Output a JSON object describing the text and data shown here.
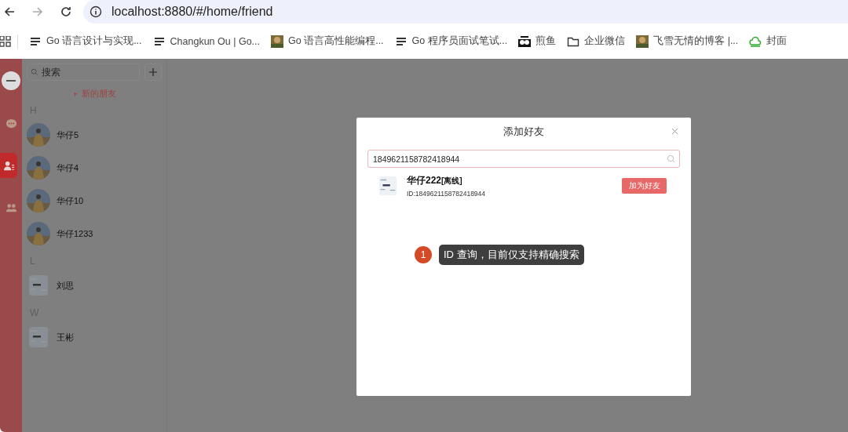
{
  "browser": {
    "url": "localhost:8880/#/home/friend",
    "bookmarks": [
      {
        "label": "Go 语言设计与实现...",
        "kind": "lines"
      },
      {
        "label": "Changkun Ou | Go...",
        "kind": "lines"
      },
      {
        "label": "Go 语言高性能编程..."
      },
      {
        "label": "Go 程序员面试笔试...",
        "kind": "lines"
      },
      {
        "label": "煎鱼",
        "kind": "logo"
      },
      {
        "label": "企业微信",
        "kind": "folder"
      },
      {
        "label": "飞雪无情的博客 |..."
      },
      {
        "label": "封面",
        "kind": "cloud"
      }
    ]
  },
  "rail": [
    {
      "kind": "avatar",
      "selected": false
    },
    {
      "kind": "chat",
      "selected": false
    },
    {
      "kind": "contacts",
      "selected": true
    },
    {
      "kind": "group",
      "selected": false
    }
  ],
  "contacts": {
    "search": {
      "placeholder": "搜索"
    },
    "new_friends": "新的朋友",
    "groups": [
      {
        "letter": "H",
        "friends": [
          {
            "name": "华仔5"
          },
          {
            "name": "华仔4"
          },
          {
            "name": "华仔10"
          },
          {
            "name": "华仔1233"
          }
        ]
      },
      {
        "letter": "L",
        "friends": [
          {
            "name": "刘思",
            "kind": "default"
          }
        ]
      },
      {
        "letter": "W",
        "friends": [
          {
            "name": "王彬",
            "kind": "default"
          }
        ]
      }
    ]
  },
  "dialog": {
    "title": "添加好友",
    "search": {
      "value": "1849621158782418944"
    },
    "result": {
      "name": "华仔222",
      "status": "[离线]",
      "id": "ID:1849621158782418944",
      "button": "加为好友",
      "kind": "default"
    },
    "callout": {
      "number": "1",
      "text": "ID 查询，目前仅支持精确搜索"
    }
  }
}
